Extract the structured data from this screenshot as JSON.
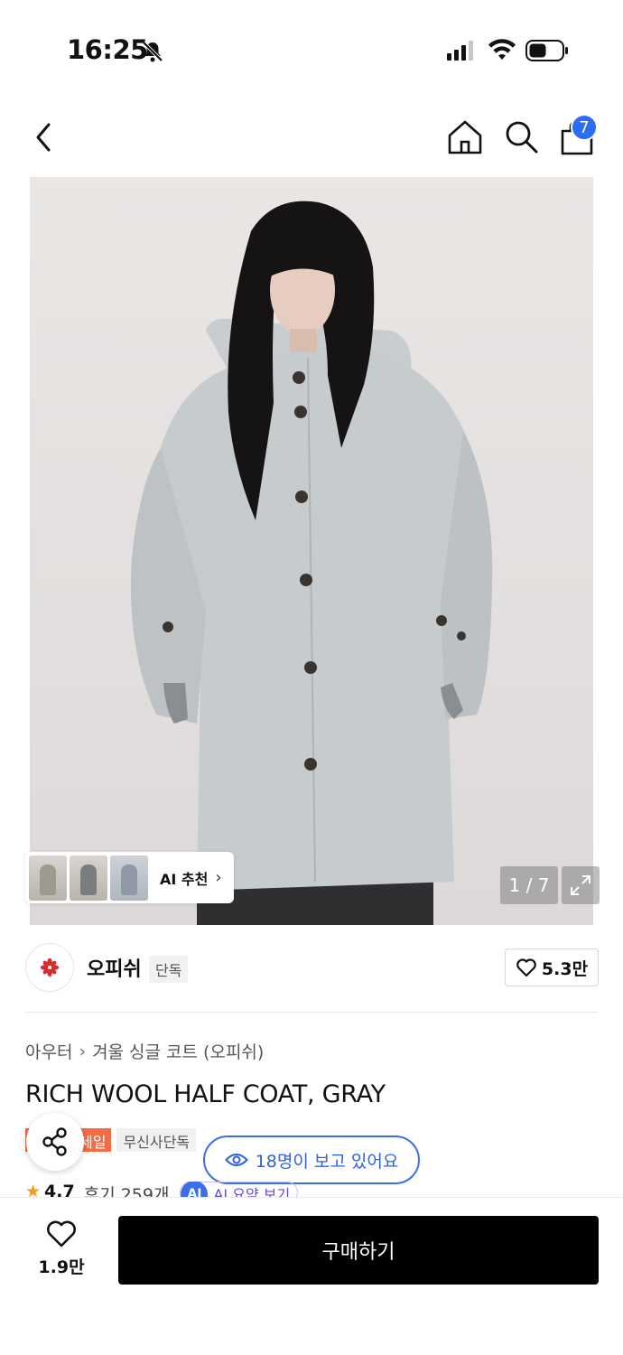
{
  "status_bar": {
    "time": "16:25"
  },
  "nav": {
    "cart_count": "7"
  },
  "gallery": {
    "ai_recommend_label": "AI 추천",
    "page_counter": "1 / 7"
  },
  "brand": {
    "name": "오피쉬",
    "tag": "단독",
    "likes": "5.3만"
  },
  "product": {
    "breadcrumb": [
      "아우터",
      "겨울 싱글 코트 (오피쉬)"
    ],
    "title": "RICH WOOL HALF COAT, GRAY",
    "badges": {
      "sale": "세일",
      "exclusive": "무신사단독"
    },
    "viewers": "18명이 보고 있어요",
    "rating": "4.7",
    "reviews": "후기 259개",
    "ai_summary": "AI 요약 보기"
  },
  "bottom_bar": {
    "wish_count": "1.9만",
    "buy_label": "구매하기"
  },
  "colors": {
    "accent_blue": "#2b6ef5",
    "sale_orange": "#f36c44",
    "buy_black": "#000000",
    "star": "#f39a1a"
  }
}
